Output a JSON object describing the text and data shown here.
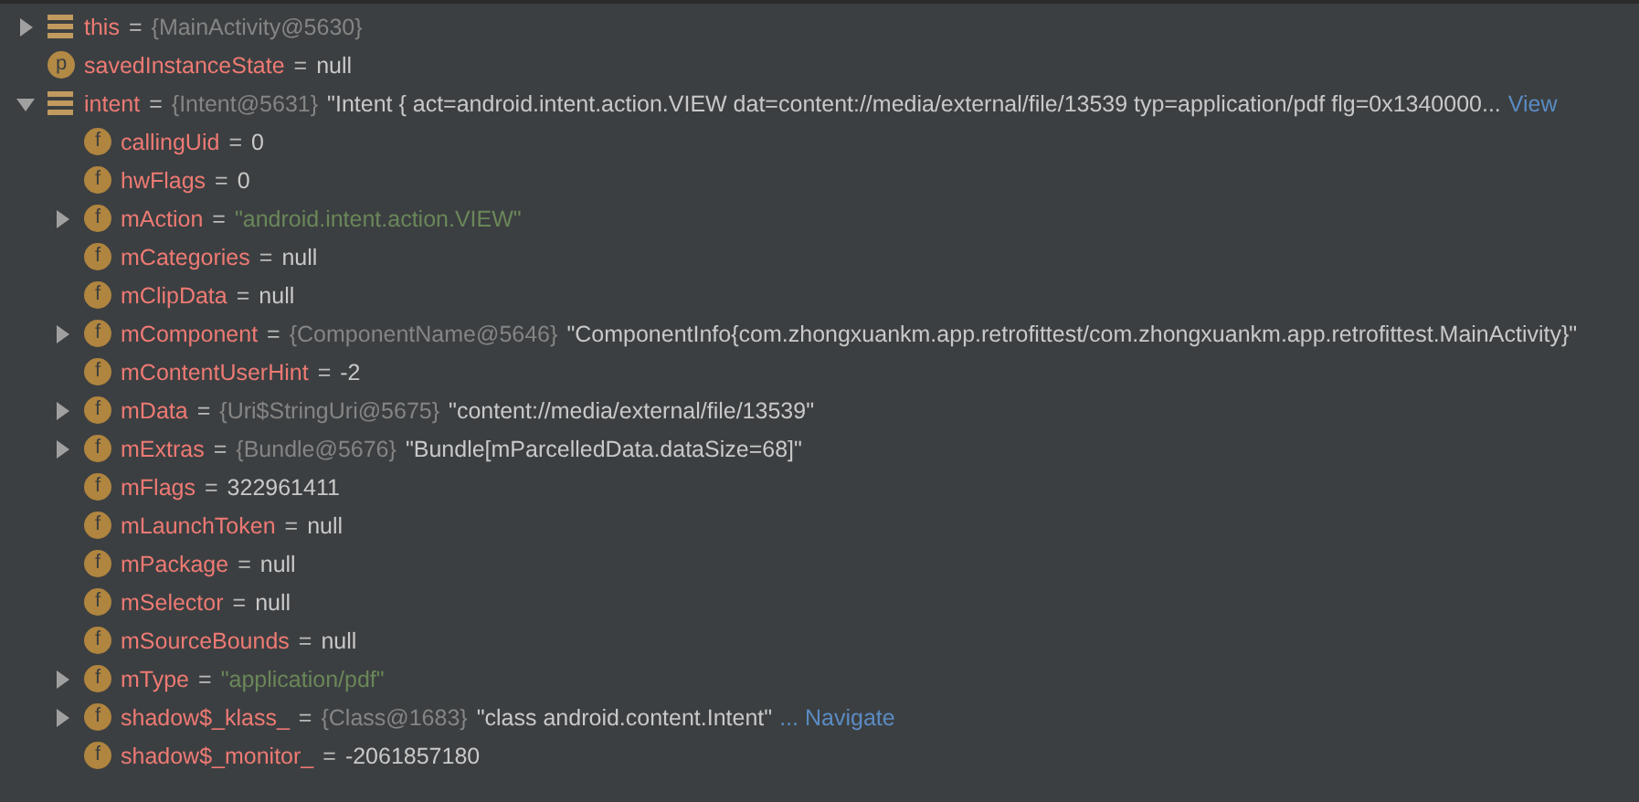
{
  "variables": [
    {
      "kind": "object",
      "name": "this",
      "sign": "=",
      "expanded": false,
      "type_ref": "{MainActivity@5630}"
    },
    {
      "kind": "param",
      "badge": "p",
      "name": "savedInstanceState",
      "sign": "=",
      "value": "null"
    },
    {
      "kind": "object",
      "name": "intent",
      "sign": "=",
      "expanded": true,
      "type_ref": "{Intent@5631}",
      "value": "\"Intent { act=android.intent.action.VIEW dat=content://media/external/file/13539 typ=application/pdf flg=0x1340000...",
      "link": "View",
      "children": [
        {
          "kind": "field",
          "badge": "f",
          "name": "callingUid",
          "sign": "=",
          "value": "0"
        },
        {
          "kind": "field",
          "badge": "f",
          "name": "hwFlags",
          "sign": "=",
          "value": "0"
        },
        {
          "kind": "field",
          "badge": "f",
          "name": "mAction",
          "sign": "=",
          "expanded": false,
          "string_value": "\"android.intent.action.VIEW\""
        },
        {
          "kind": "field",
          "badge": "f",
          "name": "mCategories",
          "sign": "=",
          "value": "null"
        },
        {
          "kind": "field",
          "badge": "f",
          "name": "mClipData",
          "sign": "=",
          "value": "null"
        },
        {
          "kind": "field",
          "badge": "f",
          "name": "mComponent",
          "sign": "=",
          "expanded": false,
          "type_ref": "{ComponentName@5646}",
          "value": "\"ComponentInfo{com.zhongxuankm.app.retrofittest/com.zhongxuankm.app.retrofittest.MainActivity}\""
        },
        {
          "kind": "field",
          "badge": "f",
          "name": "mContentUserHint",
          "sign": "=",
          "value": "-2"
        },
        {
          "kind": "field",
          "badge": "f",
          "name": "mData",
          "sign": "=",
          "expanded": false,
          "type_ref": "{Uri$StringUri@5675}",
          "value": "\"content://media/external/file/13539\""
        },
        {
          "kind": "field",
          "badge": "f",
          "name": "mExtras",
          "sign": "=",
          "expanded": false,
          "type_ref": "{Bundle@5676}",
          "value": "\"Bundle[mParcelledData.dataSize=68]\""
        },
        {
          "kind": "field",
          "badge": "f",
          "name": "mFlags",
          "sign": "=",
          "value": "322961411"
        },
        {
          "kind": "field",
          "badge": "f",
          "name": "mLaunchToken",
          "sign": "=",
          "value": "null"
        },
        {
          "kind": "field",
          "badge": "f",
          "name": "mPackage",
          "sign": "=",
          "value": "null"
        },
        {
          "kind": "field",
          "badge": "f",
          "name": "mSelector",
          "sign": "=",
          "value": "null"
        },
        {
          "kind": "field",
          "badge": "f",
          "name": "mSourceBounds",
          "sign": "=",
          "value": "null"
        },
        {
          "kind": "field",
          "badge": "f",
          "name": "mType",
          "sign": "=",
          "expanded": false,
          "string_value": "\"application/pdf\""
        },
        {
          "kind": "field",
          "badge": "f",
          "name": "shadow$_klass_",
          "sign": "=",
          "expanded": false,
          "type_ref": "{Class@1683}",
          "value": "\"class android.content.Intent\"",
          "link": "... Navigate"
        },
        {
          "kind": "field",
          "badge": "f",
          "name": "shadow$_monitor_",
          "sign": "=",
          "value": "-2061857180"
        }
      ]
    }
  ]
}
